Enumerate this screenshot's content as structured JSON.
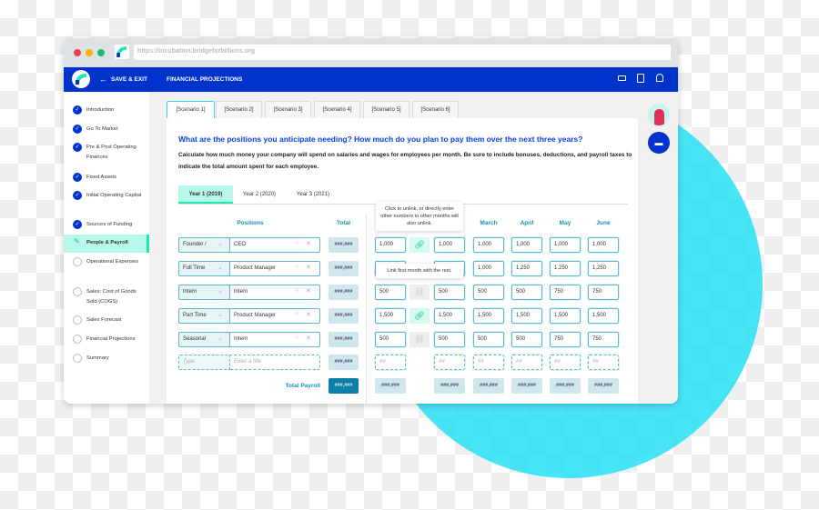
{
  "browser": {
    "url": "https://incubation.bridgeforbillions.org"
  },
  "header": {
    "save_exit": "SAVE & EXIT",
    "title": "FINANCIAL PROJECTIONS",
    "icons": [
      "video-icon",
      "calendar-icon",
      "bell-icon"
    ]
  },
  "sidebar": {
    "items": [
      {
        "label": "Introduction",
        "status": "done"
      },
      {
        "label": "Go To Market",
        "status": "done"
      },
      {
        "label": "Pre & Post Operating Finances",
        "status": "done"
      },
      {
        "label": "Fixed Assets",
        "status": "done"
      },
      {
        "label": "Initial Operating Capital",
        "status": "done"
      },
      {
        "label": "Sources of Funding",
        "status": "done"
      },
      {
        "label": "People & Payroll",
        "status": "active"
      },
      {
        "label": "Operational Expenses",
        "status": "todo"
      },
      {
        "label": "Sales: Cost of Goods Sold (COGS)",
        "status": "todo"
      },
      {
        "label": "Sales Forecast",
        "status": "todo"
      },
      {
        "label": "Financial Projections",
        "status": "todo"
      },
      {
        "label": "Summary",
        "status": "todo"
      }
    ]
  },
  "scenarios": [
    "[Scenario 1]",
    "[Scenario 2]",
    "[Scenario 3]",
    "[Scenario 4]",
    "[Scenario 5]",
    "[Scenario 6]"
  ],
  "question": "What are the positions you anticipate needing? How much do you plan to pay them over the next three years?",
  "description": "Calculate how much money your company will spend on salaries and wages for employees per month. Be sure to include bonuses, deductions, and payroll taxes to indicate the total amount spent for each employee.",
  "years": [
    "Year 1 (2019)",
    "Year 2 (2020)",
    "Year 3 (2021)"
  ],
  "table": {
    "positions_header": "Positions",
    "total_header": "Total",
    "months": [
      "March",
      "April",
      "May",
      "June"
    ],
    "rows": [
      {
        "type": "Founder /",
        "title": "CEO",
        "total": "###,###",
        "m1": "1,000",
        "link": "linked",
        "m2": "1,000",
        "m3": "1,000",
        "m4": "1,000",
        "m5": "1,000",
        "m6": "1,000"
      },
      {
        "type": "Full Time",
        "title": "Product Manager",
        "total": "###,###",
        "m1": "",
        "link": "",
        "m2": "",
        "m3": "1,000",
        "m4": "1,250",
        "m5": "1,250",
        "m6": "1,250"
      },
      {
        "type": "Intern",
        "title": "Intern",
        "total": "###,###",
        "m1": "500",
        "link": "unlinked",
        "m2": "500",
        "m3": "500",
        "m4": "500",
        "m5": "750",
        "m6": "750"
      },
      {
        "type": "Part Time",
        "title": "Product Manager",
        "total": "###,###",
        "m1": "1,500",
        "link": "linked",
        "m2": "1,500",
        "m3": "1,500",
        "m4": "1,500",
        "m5": "1,500",
        "m6": "1,500"
      },
      {
        "type": "Seasonal",
        "title": "Intern",
        "total": "###,###",
        "m1": "500",
        "link": "unlinked",
        "m2": "500",
        "m3": "500",
        "m4": "500",
        "m5": "750",
        "m6": "750"
      }
    ],
    "new_row": {
      "type_placeholder": "Type",
      "title_placeholder": "Enter a title",
      "total": "###,###",
      "month_placeholder": "##"
    },
    "total_payroll_label": "Total Payroll",
    "total_payroll": "###,###",
    "month_total": "###,###"
  },
  "tooltips": {
    "unlink": "Click to unlink, or directly enter other numbers in other months will also unlink.",
    "link": "Link first month with the rest."
  },
  "colors": {
    "brand": "#0033cc",
    "accent": "#1de8b0",
    "field": "#5fb8cc"
  }
}
